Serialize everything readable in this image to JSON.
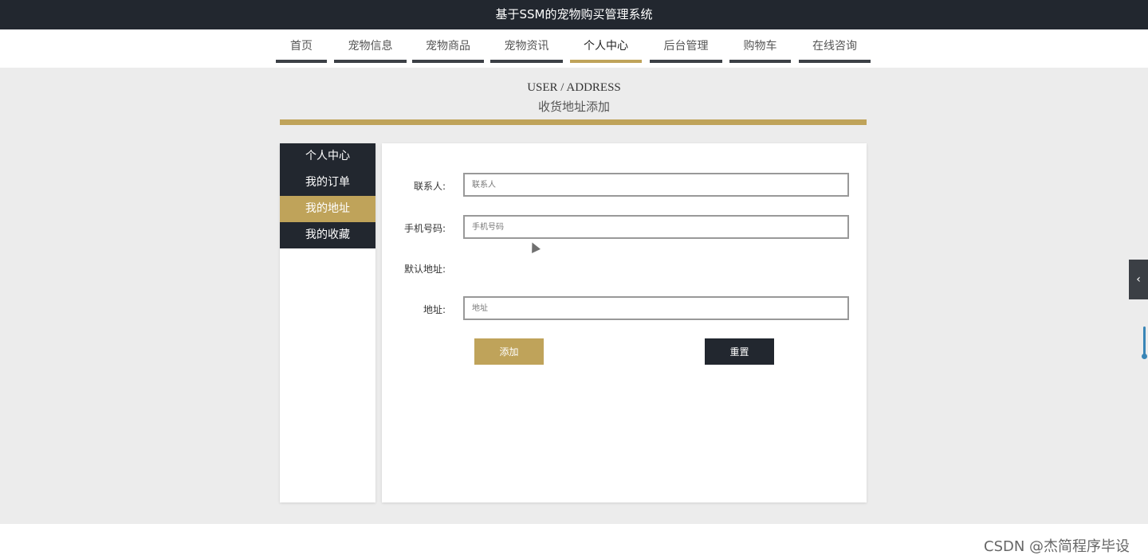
{
  "header": {
    "title": "基于SSM的宠物购买管理系统"
  },
  "nav": {
    "items": [
      {
        "label": "首页"
      },
      {
        "label": "宠物信息"
      },
      {
        "label": "宠物商品"
      },
      {
        "label": "宠物资讯"
      },
      {
        "label": "个人中心"
      },
      {
        "label": "后台管理"
      },
      {
        "label": "购物车"
      },
      {
        "label": "在线咨询"
      }
    ],
    "active": "个人中心"
  },
  "page": {
    "title_en": "USER / ADDRESS",
    "title_cn": "收货地址添加"
  },
  "sidebar": {
    "items": [
      {
        "label": "个人中心"
      },
      {
        "label": "我的订单"
      },
      {
        "label": "我的地址"
      },
      {
        "label": "我的收藏"
      }
    ],
    "active": "我的地址"
  },
  "form": {
    "contact": {
      "label": "联系人:",
      "placeholder": "联系人",
      "value": ""
    },
    "phone": {
      "label": "手机号码:",
      "placeholder": "手机号码",
      "value": ""
    },
    "default_address": {
      "label": "默认地址:"
    },
    "address": {
      "label": "地址:",
      "placeholder": "地址",
      "value": ""
    },
    "add_label": "添加",
    "reset_label": "重置"
  },
  "side_tab": {
    "icon": "chevron-left-icon",
    "glyph": "‹"
  },
  "watermark": "CSDN @杰简程序毕设",
  "colors": {
    "accent": "#bfa35a",
    "dark": "#22272f",
    "background": "#ececec"
  }
}
